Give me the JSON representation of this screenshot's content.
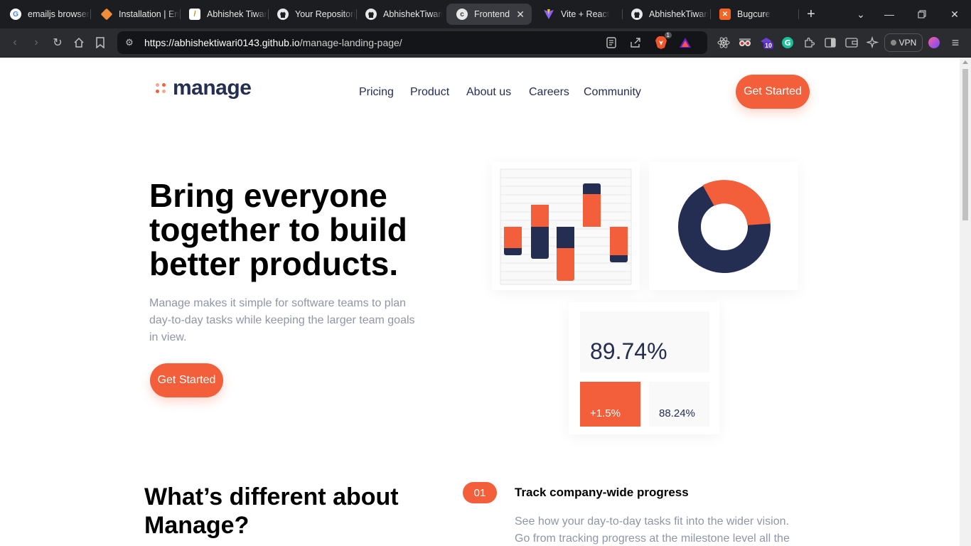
{
  "browser": {
    "tabs": [
      {
        "title": "emailjs browser",
        "active": false
      },
      {
        "title": "Installation | EmailJS",
        "active": false
      },
      {
        "title": "Abhishek Tiwari",
        "active": false
      },
      {
        "title": "Your Repositories",
        "active": false
      },
      {
        "title": "AbhishekTiwari",
        "active": false
      },
      {
        "title": "Frontend",
        "active": true
      },
      {
        "title": "Vite + React",
        "active": false
      },
      {
        "title": "AbhishekTiwari",
        "active": false
      },
      {
        "title": "Bugcure",
        "active": false
      }
    ],
    "url_host": "https://abhishektiwari0143.github.io",
    "url_path": "/manage-landing-page/",
    "brave_badge": "1",
    "ext_badge": "10",
    "vpn_label": "VPN"
  },
  "site": {
    "logo": "manage",
    "nav": [
      "Pricing",
      "Product",
      "About us",
      "Careers",
      "Community"
    ],
    "header_cta": "Get Started",
    "hero_title": "Bring everyone together to build better products.",
    "hero_desc": "Manage makes it simple for software teams to plan day-to-day tasks while keeping the larger team goals in view.",
    "hero_cta": "Get Started",
    "stats": {
      "main": "89.74%",
      "change": "+1.5%",
      "secondary": "88.24%"
    },
    "section_title": "What’s different about Manage?",
    "feature": {
      "number": "01",
      "title": "Track company-wide progress",
      "desc": "See how your day-to-day tasks fit into the wider vision. Go from tracking progress at the milestone level all the way down to the smallest of details."
    },
    "colors": {
      "accent": "#f25f3a",
      "navy": "#242d52",
      "muted": "#9095a7"
    }
  }
}
